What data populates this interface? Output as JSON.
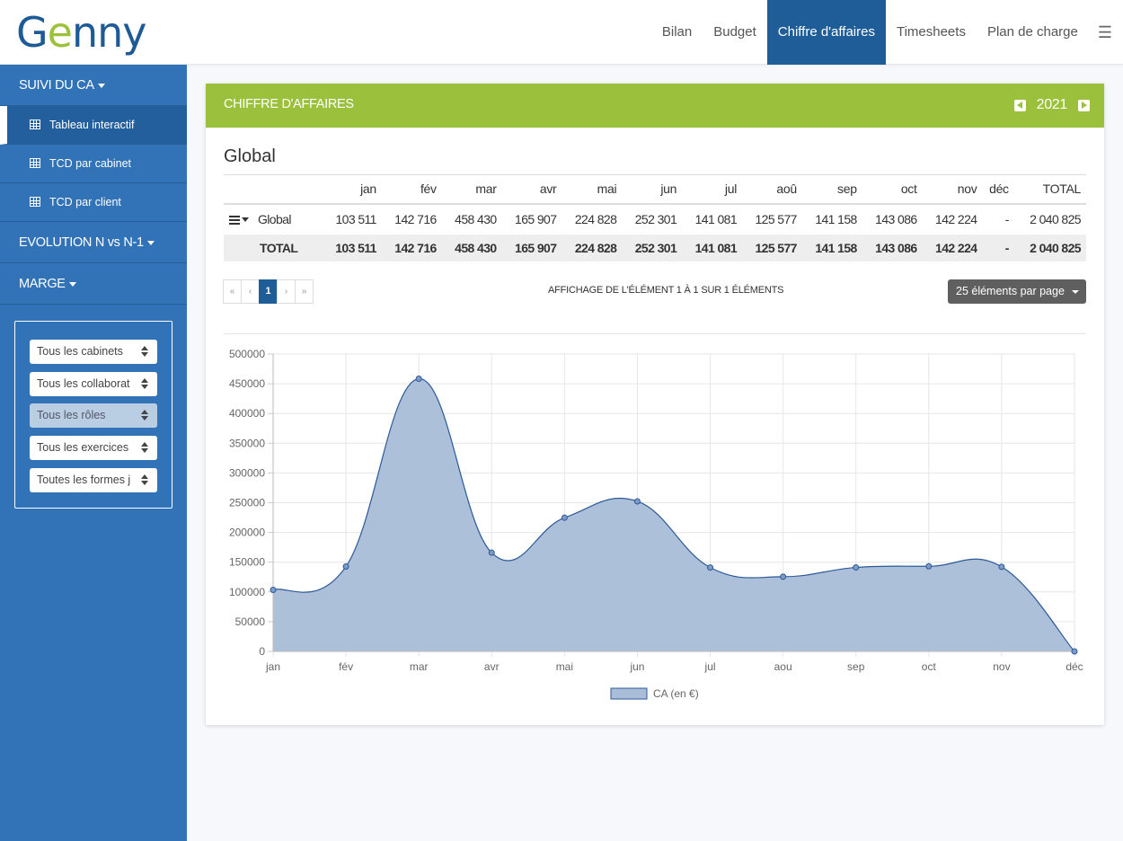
{
  "app": {
    "logo_g": "G",
    "logo_e": "e",
    "logo_rest": "nny"
  },
  "nav": {
    "items": [
      "Bilan",
      "Budget",
      "Chiffre d'affaires",
      "Timesheets",
      "Plan de charge"
    ],
    "active_index": 2
  },
  "sidebar": {
    "sections": [
      {
        "label": "SUIVI DU CA"
      },
      {
        "label": "EVOLUTION N vs N-1"
      },
      {
        "label": "MARGE"
      }
    ],
    "items": [
      {
        "label": "Tableau interactif",
        "active": true
      },
      {
        "label": "TCD par cabinet",
        "active": false
      },
      {
        "label": "TCD par client",
        "active": false
      }
    ],
    "filters": [
      {
        "value": "Tous les cabinets",
        "disabled": false
      },
      {
        "value": "Tous les collaborateurs",
        "disabled": false
      },
      {
        "value": "Tous les rôles",
        "disabled": true
      },
      {
        "value": "Tous les exercices",
        "disabled": false
      },
      {
        "value": "Toutes les formes juridiques",
        "disabled": false
      }
    ]
  },
  "panel": {
    "title": "CHIFFRE D'AFFAIRES",
    "year": "2021",
    "section_title": "Global",
    "table": {
      "headers": [
        "",
        "jan",
        "fév",
        "mar",
        "avr",
        "mai",
        "jun",
        "jul",
        "aoû",
        "sep",
        "oct",
        "nov",
        "déc",
        "TOTAL"
      ],
      "rows": [
        {
          "label": "Global",
          "values": [
            "103 511",
            "142 716",
            "458 430",
            "165 907",
            "224 828",
            "252 301",
            "141 081",
            "125 577",
            "141 158",
            "143 086",
            "142 224",
            "-",
            "2 040 825"
          ]
        }
      ],
      "total": {
        "label": "TOTAL",
        "values": [
          "103 511",
          "142 716",
          "458 430",
          "165 907",
          "224 828",
          "252 301",
          "141 081",
          "125 577",
          "141 158",
          "143 086",
          "142 224",
          "-",
          "2 040 825"
        ]
      }
    },
    "pager": {
      "first": "«",
      "prev": "‹",
      "current": "1",
      "next": "›",
      "last": "»"
    },
    "info": "AFFICHAGE DE L'ÉLÉMENT 1 À 1 SUR 1 ÉLÉMENTS",
    "per_page": "25 éléments par page"
  },
  "chart_data": {
    "type": "area",
    "categories": [
      "jan",
      "fév",
      "mar",
      "avr",
      "mai",
      "jun",
      "jul",
      "aou",
      "sep",
      "oct",
      "nov",
      "déc"
    ],
    "series": [
      {
        "name": "CA (en €)",
        "values": [
          103511,
          142716,
          458430,
          165907,
          224828,
          252301,
          141081,
          125577,
          141158,
          143086,
          142224,
          0
        ],
        "color": "#a9bdd8",
        "stroke": "#2d5a98"
      }
    ],
    "ylim": [
      0,
      500000
    ],
    "yticks": [
      0,
      50000,
      100000,
      150000,
      200000,
      250000,
      300000,
      350000,
      400000,
      450000,
      500000
    ],
    "grid": true,
    "legend": "bottom"
  }
}
